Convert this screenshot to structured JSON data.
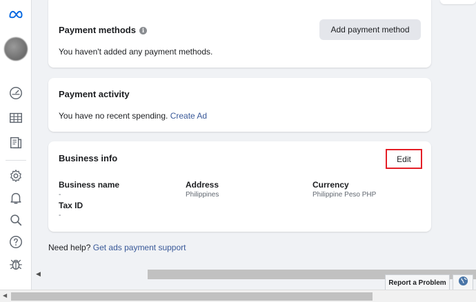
{
  "sidebar": {
    "logo": "meta-logo",
    "icons": [
      "dashboard-icon",
      "table-icon",
      "pages-icon",
      "gear-icon",
      "bell-icon",
      "search-icon",
      "help-icon",
      "bug-icon"
    ]
  },
  "payment_methods": {
    "title": "Payment methods",
    "info": "i",
    "add_button": "Add payment method",
    "empty_text": "You haven't added any payment methods."
  },
  "payment_activity": {
    "title": "Payment activity",
    "text": "You have no recent spending.",
    "link": "Create Ad"
  },
  "business_info": {
    "title": "Business info",
    "edit_button": "Edit",
    "fields": {
      "business_name": {
        "label": "Business name",
        "value": "-"
      },
      "address": {
        "label": "Address",
        "value": "Philippines"
      },
      "currency": {
        "label": "Currency",
        "value": "Philippine Peso PHP"
      },
      "tax_id": {
        "label": "Tax ID",
        "value": "-"
      }
    }
  },
  "help": {
    "text": "Need help?",
    "link": "Get ads payment support"
  },
  "footer": {
    "report_button": "Report a Problem"
  },
  "colors": {
    "accent_link": "#385898",
    "highlight_border": "#e41e26",
    "meta_blue": "#0668e1"
  }
}
